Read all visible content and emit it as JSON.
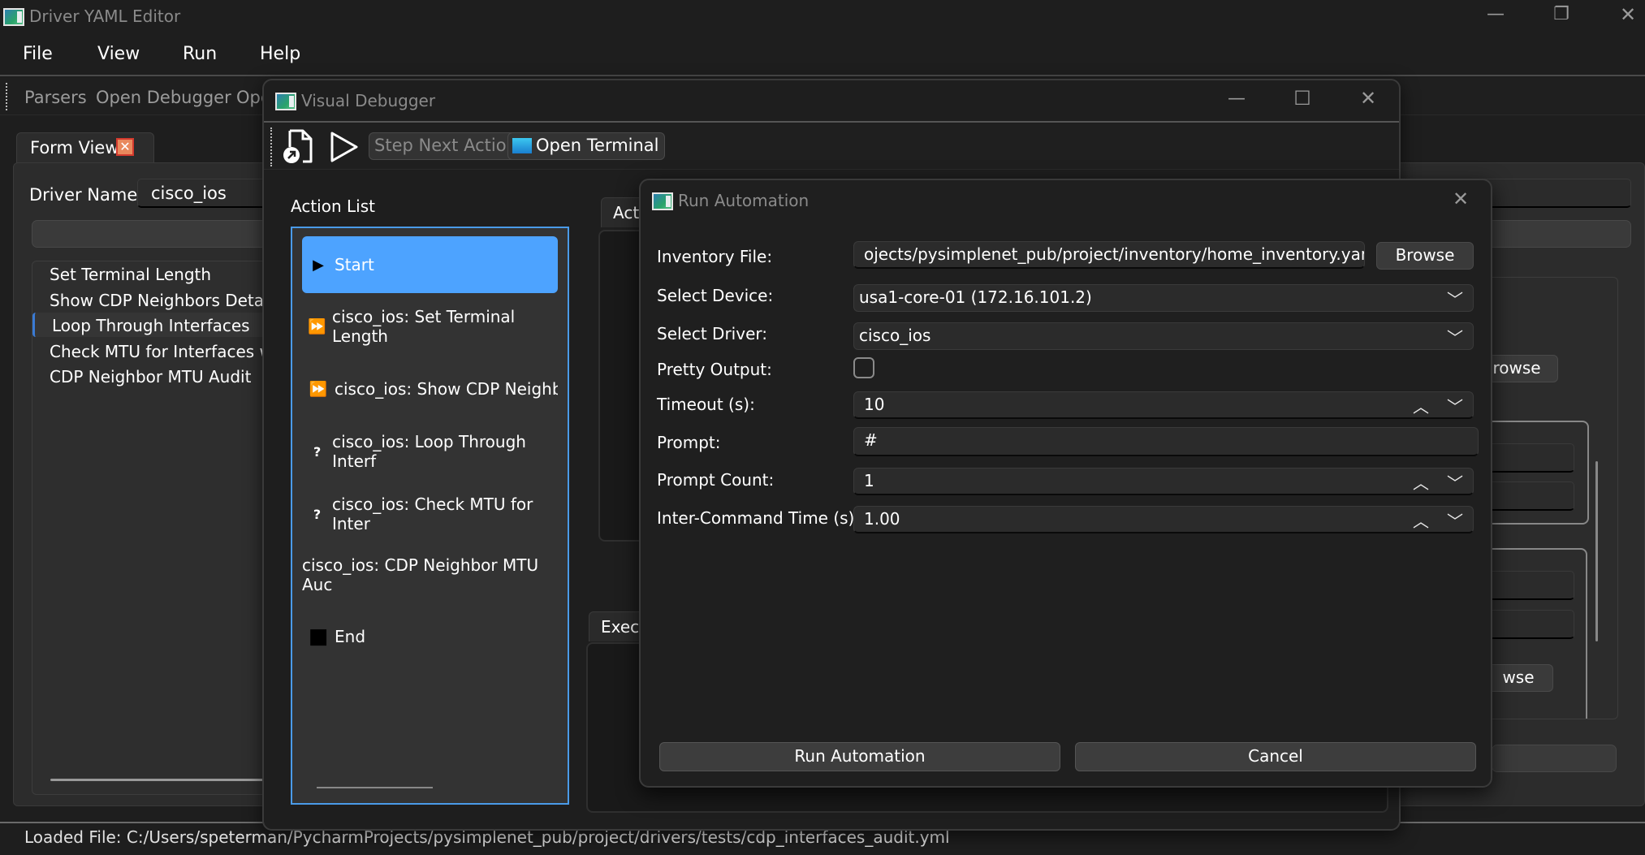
{
  "main_window": {
    "title": "Driver YAML Editor",
    "controls": {
      "minimize": "—",
      "restore": "❐",
      "close": "✕"
    }
  },
  "menu": {
    "items": [
      {
        "label": "File"
      },
      {
        "label": "View"
      },
      {
        "label": "Run"
      },
      {
        "label": "Help"
      }
    ]
  },
  "toolbar": {
    "items": [
      {
        "label": "Parsers"
      },
      {
        "label": "Open Debugger"
      },
      {
        "label": "Ope"
      }
    ]
  },
  "form_view": {
    "tab_label": "Form View",
    "tab_close": "✕",
    "driver_name_label": "Driver Name:",
    "driver_name_value": "cisco_ios",
    "actions": [
      {
        "label": "Set Terminal Length"
      },
      {
        "label": "Show CDP Neighbors Detail"
      },
      {
        "label": "Loop Through Interfaces"
      },
      {
        "label": "Check MTU for Interfaces with"
      },
      {
        "label": "CDP Neighbor MTU Audit"
      }
    ],
    "selected_action_index": 2,
    "right_browse_1": "rowse",
    "right_browse_2": "wse"
  },
  "status_bar": {
    "text": "Loaded File: C:/Users/speterman/PycharmProjects/pysimplenet_pub/project/drivers/tests/cdp_interfaces_audit.yml"
  },
  "debugger": {
    "title": "Visual Debugger",
    "controls": {
      "minimize": "—",
      "maximize": "☐",
      "close": "✕"
    },
    "toolbar": {
      "step_next_label": "Step Next Action",
      "open_terminal_label": "Open Terminal"
    },
    "action_list_label": "Action List",
    "action_list": [
      {
        "icon": "▶",
        "icon_name": "play-icon",
        "label": "Start",
        "selected": true
      },
      {
        "icon": "⏩",
        "icon_name": "fast-forward-icon",
        "label": "cisco_ios: Set Terminal Length"
      },
      {
        "icon": "⏩",
        "icon_name": "fast-forward-icon",
        "label": "cisco_ios: Show CDP Neighbor"
      },
      {
        "icon": "?",
        "icon_name": "question-icon",
        "label": "cisco_ios: Loop Through Interf"
      },
      {
        "icon": "?",
        "icon_name": "question-icon",
        "label": "cisco_ios: Check MTU for Inter"
      },
      {
        "icon": "",
        "icon_name": "none",
        "label": "cisco_ios: CDP Neighbor MTU Auc"
      },
      {
        "icon": "■",
        "icon_name": "stop-icon",
        "label": "End"
      }
    ],
    "action_tab_label": "Act",
    "execution_tab_label": "Execu"
  },
  "run_dialog": {
    "title": "Run Automation",
    "close": "✕",
    "fields": {
      "inventory_label": "Inventory File:",
      "inventory_value": "ojects/pysimplenet_pub/project/inventory/home_inventory.yaml",
      "browse_label": "Browse",
      "device_label": "Select Device:",
      "device_value": "usa1-core-01 (172.16.101.2)",
      "driver_label": "Select Driver:",
      "driver_value": "cisco_ios",
      "pretty_label": "Pretty Output:",
      "pretty_checked": false,
      "timeout_label": "Timeout (s):",
      "timeout_value": "10",
      "prompt_label": "Prompt:",
      "prompt_value": "#",
      "prompt_count_label": "Prompt Count:",
      "prompt_count_value": "1",
      "inter_command_label": "Inter-Command Time (s):",
      "inter_command_value": "1.00"
    },
    "run_button": "Run Automation",
    "cancel_button": "Cancel"
  },
  "colors": {
    "accent": "#4da3ff",
    "background": "#1e1e1e",
    "panel": "#2c2c2c",
    "close_badge": "#e9895d"
  }
}
